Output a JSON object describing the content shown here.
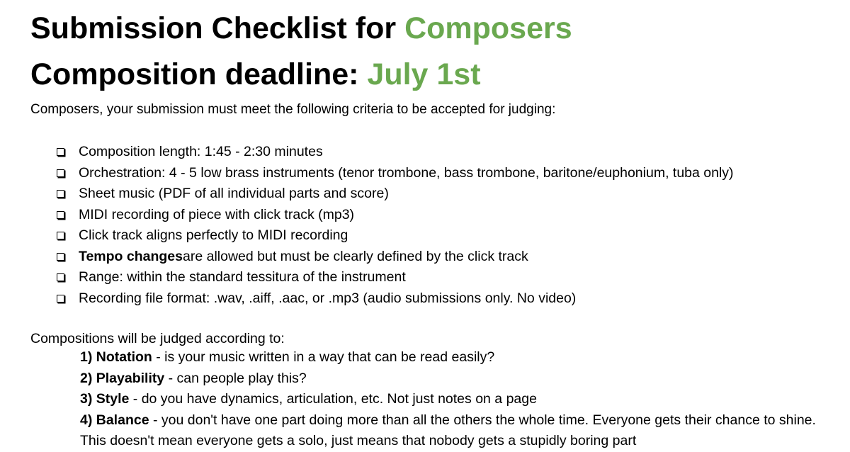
{
  "title1": {
    "prefix": "Submission Checklist for ",
    "accent": "Composers"
  },
  "title2": {
    "prefix": "Composition deadline: ",
    "accent": "July 1st"
  },
  "intro": "Composers, your submission must meet the following criteria to be accepted for judging:",
  "checklist": [
    {
      "bold": "",
      "text": "Composition length: 1:45 - 2:30 minutes"
    },
    {
      "bold": "",
      "text": "Orchestration: 4 - 5 low brass instruments (tenor trombone, bass trombone, baritone/euphonium, tuba only)"
    },
    {
      "bold": "",
      "text": "Sheet music (PDF of all individual parts and score)"
    },
    {
      "bold": "",
      "text": "MIDI recording of piece with click track (mp3)"
    },
    {
      "bold": "",
      "text": "Click track aligns perfectly to MIDI recording"
    },
    {
      "bold": "Tempo changes",
      "text": " are allowed but must be clearly defined by the click track"
    },
    {
      "bold": "",
      "text": "Range: within the standard tessitura of the instrument"
    },
    {
      "bold": "",
      "text": "Recording file format: .wav, .aiff, .aac, or .mp3 (audio submissions only. No video)"
    }
  ],
  "judged_heading": "Compositions will be judged according to:",
  "criteria": [
    {
      "bold": "1) Notation",
      "text": " - is your music written in a way that can be read easily?"
    },
    {
      "bold": "2) Playability",
      "text": " - can people play this?"
    },
    {
      "bold": "3) Style",
      "text": " - do you have dynamics, articulation, etc. Not just notes on a page"
    },
    {
      "bold": "4) Balance",
      "text": " - you don't have one part doing more than all the others the whole time. Everyone gets their chance to shine. This doesn't mean everyone gets a solo, just means that nobody gets a stupidly boring part"
    }
  ],
  "colors": {
    "accent": "#6aa84f",
    "text": "#000000"
  }
}
